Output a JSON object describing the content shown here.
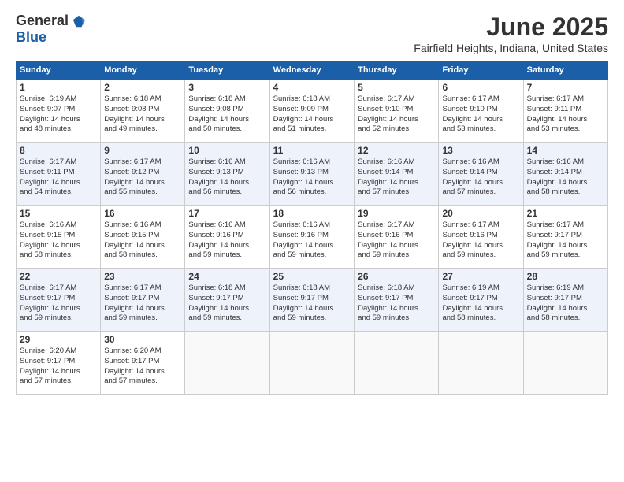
{
  "header": {
    "logo_general": "General",
    "logo_blue": "Blue",
    "title": "June 2025",
    "location": "Fairfield Heights, Indiana, United States"
  },
  "weekdays": [
    "Sunday",
    "Monday",
    "Tuesday",
    "Wednesday",
    "Thursday",
    "Friday",
    "Saturday"
  ],
  "weeks": [
    [
      {
        "day": "1",
        "info": "Sunrise: 6:19 AM\nSunset: 9:07 PM\nDaylight: 14 hours\nand 48 minutes."
      },
      {
        "day": "2",
        "info": "Sunrise: 6:18 AM\nSunset: 9:08 PM\nDaylight: 14 hours\nand 49 minutes."
      },
      {
        "day": "3",
        "info": "Sunrise: 6:18 AM\nSunset: 9:08 PM\nDaylight: 14 hours\nand 50 minutes."
      },
      {
        "day": "4",
        "info": "Sunrise: 6:18 AM\nSunset: 9:09 PM\nDaylight: 14 hours\nand 51 minutes."
      },
      {
        "day": "5",
        "info": "Sunrise: 6:17 AM\nSunset: 9:10 PM\nDaylight: 14 hours\nand 52 minutes."
      },
      {
        "day": "6",
        "info": "Sunrise: 6:17 AM\nSunset: 9:10 PM\nDaylight: 14 hours\nand 53 minutes."
      },
      {
        "day": "7",
        "info": "Sunrise: 6:17 AM\nSunset: 9:11 PM\nDaylight: 14 hours\nand 53 minutes."
      }
    ],
    [
      {
        "day": "8",
        "info": "Sunrise: 6:17 AM\nSunset: 9:11 PM\nDaylight: 14 hours\nand 54 minutes."
      },
      {
        "day": "9",
        "info": "Sunrise: 6:17 AM\nSunset: 9:12 PM\nDaylight: 14 hours\nand 55 minutes."
      },
      {
        "day": "10",
        "info": "Sunrise: 6:16 AM\nSunset: 9:13 PM\nDaylight: 14 hours\nand 56 minutes."
      },
      {
        "day": "11",
        "info": "Sunrise: 6:16 AM\nSunset: 9:13 PM\nDaylight: 14 hours\nand 56 minutes."
      },
      {
        "day": "12",
        "info": "Sunrise: 6:16 AM\nSunset: 9:14 PM\nDaylight: 14 hours\nand 57 minutes."
      },
      {
        "day": "13",
        "info": "Sunrise: 6:16 AM\nSunset: 9:14 PM\nDaylight: 14 hours\nand 57 minutes."
      },
      {
        "day": "14",
        "info": "Sunrise: 6:16 AM\nSunset: 9:14 PM\nDaylight: 14 hours\nand 58 minutes."
      }
    ],
    [
      {
        "day": "15",
        "info": "Sunrise: 6:16 AM\nSunset: 9:15 PM\nDaylight: 14 hours\nand 58 minutes."
      },
      {
        "day": "16",
        "info": "Sunrise: 6:16 AM\nSunset: 9:15 PM\nDaylight: 14 hours\nand 58 minutes."
      },
      {
        "day": "17",
        "info": "Sunrise: 6:16 AM\nSunset: 9:16 PM\nDaylight: 14 hours\nand 59 minutes."
      },
      {
        "day": "18",
        "info": "Sunrise: 6:16 AM\nSunset: 9:16 PM\nDaylight: 14 hours\nand 59 minutes."
      },
      {
        "day": "19",
        "info": "Sunrise: 6:17 AM\nSunset: 9:16 PM\nDaylight: 14 hours\nand 59 minutes."
      },
      {
        "day": "20",
        "info": "Sunrise: 6:17 AM\nSunset: 9:16 PM\nDaylight: 14 hours\nand 59 minutes."
      },
      {
        "day": "21",
        "info": "Sunrise: 6:17 AM\nSunset: 9:17 PM\nDaylight: 14 hours\nand 59 minutes."
      }
    ],
    [
      {
        "day": "22",
        "info": "Sunrise: 6:17 AM\nSunset: 9:17 PM\nDaylight: 14 hours\nand 59 minutes."
      },
      {
        "day": "23",
        "info": "Sunrise: 6:17 AM\nSunset: 9:17 PM\nDaylight: 14 hours\nand 59 minutes."
      },
      {
        "day": "24",
        "info": "Sunrise: 6:18 AM\nSunset: 9:17 PM\nDaylight: 14 hours\nand 59 minutes."
      },
      {
        "day": "25",
        "info": "Sunrise: 6:18 AM\nSunset: 9:17 PM\nDaylight: 14 hours\nand 59 minutes."
      },
      {
        "day": "26",
        "info": "Sunrise: 6:18 AM\nSunset: 9:17 PM\nDaylight: 14 hours\nand 59 minutes."
      },
      {
        "day": "27",
        "info": "Sunrise: 6:19 AM\nSunset: 9:17 PM\nDaylight: 14 hours\nand 58 minutes."
      },
      {
        "day": "28",
        "info": "Sunrise: 6:19 AM\nSunset: 9:17 PM\nDaylight: 14 hours\nand 58 minutes."
      }
    ],
    [
      {
        "day": "29",
        "info": "Sunrise: 6:20 AM\nSunset: 9:17 PM\nDaylight: 14 hours\nand 57 minutes."
      },
      {
        "day": "30",
        "info": "Sunrise: 6:20 AM\nSunset: 9:17 PM\nDaylight: 14 hours\nand 57 minutes."
      },
      {
        "day": "",
        "info": ""
      },
      {
        "day": "",
        "info": ""
      },
      {
        "day": "",
        "info": ""
      },
      {
        "day": "",
        "info": ""
      },
      {
        "day": "",
        "info": ""
      }
    ]
  ]
}
